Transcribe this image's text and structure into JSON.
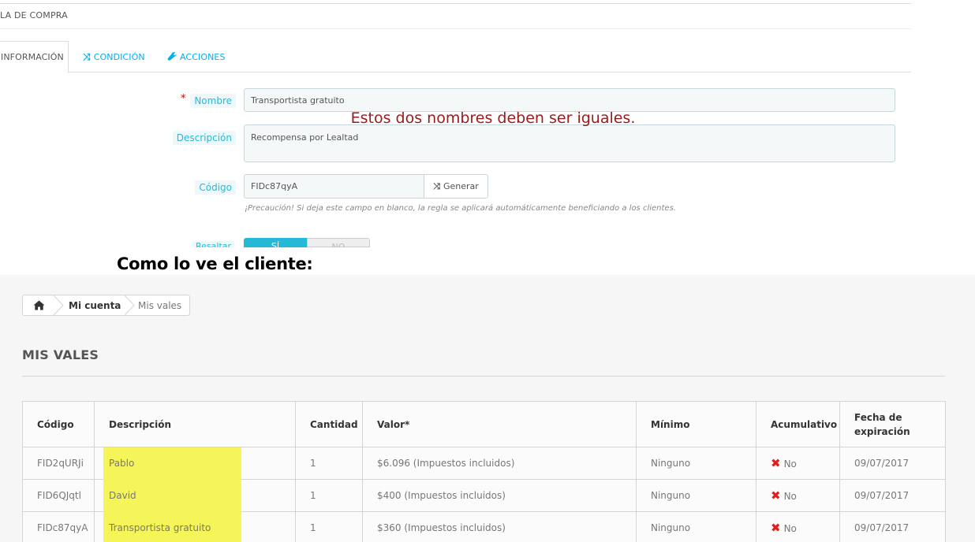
{
  "admin": {
    "heading": "LA DE COMPRA",
    "tabs": [
      {
        "label": "INFORMACIÓN",
        "icon": "info-icon"
      },
      {
        "label": "CONDICIÓN",
        "icon": "shuffle-icon"
      },
      {
        "label": "ACCIONES",
        "icon": "wrench-icon"
      }
    ],
    "form": {
      "nombre_label": "Nombre",
      "nombre_value": "Transportista gratuito",
      "descripcion_label": "Descripción",
      "descripcion_value": "Recompensa por Lealtad",
      "codigo_label": "Código",
      "codigo_value": "FIDc87qyA",
      "generar_label": "Generar",
      "help_text": "¡Precaución! Si deja este campo en blanco, la regla se aplicará automáticamente beneficiando a los clientes.",
      "resaltar_label": "Resaltar",
      "switch_on": "SÍ",
      "switch_off": "NO"
    },
    "annotation": "Estos dos nombres deben ser iguales."
  },
  "caption": "Como lo ve el cliente:",
  "client": {
    "breadcrumb": [
      "Mi cuenta",
      "Mis vales"
    ],
    "page_title": "MIS VALES",
    "table": {
      "headers": [
        "Código",
        "Descripción",
        "Cantidad",
        "Valor*",
        "Mínimo",
        "Acumulativo",
        "Fecha de expiración"
      ],
      "rows": [
        [
          "FID2qURJi",
          "Pablo",
          "1",
          "$6.096 (Impuestos incluidos)",
          "Ninguno",
          "No",
          "09/07/2017"
        ],
        [
          "FID6QJqtl",
          "David",
          "1",
          "$400 (Impuestos incluidos)",
          "Ninguno",
          "No",
          "09/07/2017"
        ],
        [
          "FIDc87qyA",
          "Transportista gratuito",
          "1",
          "$360 (Impuestos incluidos)",
          "Ninguno",
          "No",
          "09/07/2017"
        ]
      ]
    }
  },
  "colors": {
    "accent": "#25b9d7",
    "link": "#00aff0",
    "required": "#cc0000",
    "annotation": "#9b1b1b",
    "highlight": "#f5f55a",
    "cross": "#e31e1e"
  }
}
